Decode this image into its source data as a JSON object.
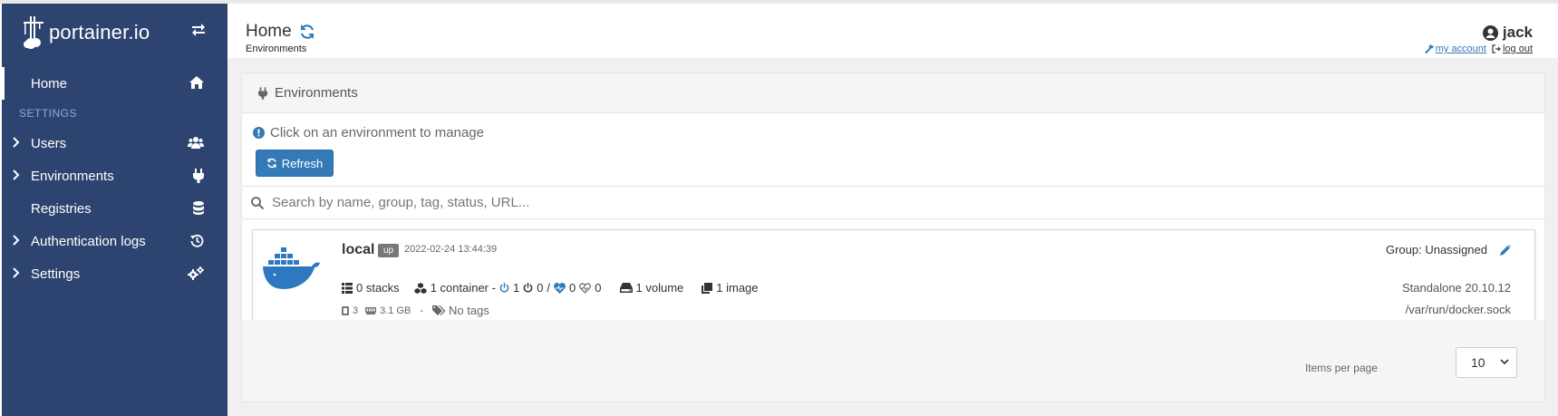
{
  "brand": {
    "name": "portainer.io"
  },
  "sidebar": {
    "home": "Home",
    "settings_section": "SETTINGS",
    "items": [
      {
        "label": "Users",
        "icon": "users-icon",
        "expandable": true
      },
      {
        "label": "Environments",
        "icon": "plug-icon",
        "expandable": true
      },
      {
        "label": "Registries",
        "icon": "database-icon",
        "expandable": false
      },
      {
        "label": "Authentication logs",
        "icon": "history-icon",
        "expandable": true
      },
      {
        "label": "Settings",
        "icon": "cogs-icon",
        "expandable": true
      }
    ]
  },
  "header": {
    "title": "Home",
    "breadcrumb": "Environments",
    "user": "jack",
    "my_account": "my account",
    "log_out": "log out"
  },
  "widget": {
    "title": "Environments",
    "info": "Click on an environment to manage",
    "refresh_label": "Refresh",
    "search_placeholder": "Search by name, group, tag, status, URL..."
  },
  "environment": {
    "name": "local",
    "status": "up",
    "date": "2022-02-24 13:44:39",
    "group": "Group: Unassigned",
    "stacks": "0 stacks",
    "containers": "1 container -",
    "running": "1",
    "stopped": "0",
    "slash": "/",
    "healthy": "0",
    "unhealthy": "0",
    "volumes": "1 volume",
    "images": "1 image",
    "cpu": "3",
    "memory": "3.1 GB",
    "dash": "-",
    "tags": "No tags",
    "version": "Standalone 20.10.12",
    "url": "/var/run/docker.sock"
  },
  "pagination": {
    "items_per_page_label": "Items per page",
    "items_per_page_value": "10"
  },
  "colors": {
    "sidebar_bg": "#2e4470",
    "accent": "#337ab7",
    "docker_blue": "#2d78c0"
  }
}
